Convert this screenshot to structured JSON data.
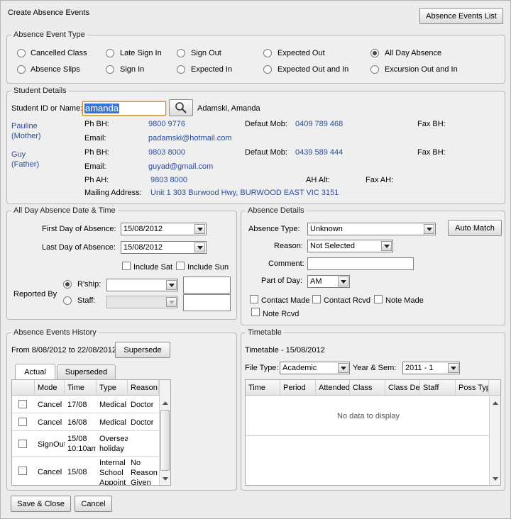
{
  "window": {
    "title": "Create Absence Events",
    "events_list_button": "Absence Events List"
  },
  "event_type": {
    "legend": "Absence Event Type",
    "options": [
      {
        "label": "Cancelled Class",
        "selected": false
      },
      {
        "label": "Late Sign In",
        "selected": false
      },
      {
        "label": "Sign Out",
        "selected": false
      },
      {
        "label": "Expected Out",
        "selected": false
      },
      {
        "label": "All Day Absence",
        "selected": true
      },
      {
        "label": "Absence Slips",
        "selected": false
      },
      {
        "label": "Sign In",
        "selected": false
      },
      {
        "label": "Expected In",
        "selected": false
      },
      {
        "label": "Expected Out and In",
        "selected": false
      },
      {
        "label": "Excursion Out and In",
        "selected": false
      }
    ]
  },
  "student": {
    "legend": "Student Details",
    "id_label": "Student ID or Name:",
    "id_value": "amanda",
    "name": "Adamski, Amanda",
    "contacts": [
      {
        "name": "Pauline",
        "relation": "(Mother)",
        "ph_bh_label": "Ph BH:",
        "ph_bh": "9800 9776",
        "mob_label": "Defaut Mob:",
        "mob": "0409 789 468",
        "fax_label": "Fax BH:",
        "email_label": "Email:",
        "email": "padamski@hotmail.com"
      },
      {
        "name": "Guy",
        "relation": "(Father)",
        "ph_bh_label": "Ph BH:",
        "ph_bh": "9803 8000",
        "mob_label": "Defaut Mob:",
        "mob": "0439 589 444",
        "fax_label": "Fax BH:",
        "email_label": "Email:",
        "email": "guyad@gmail.com"
      }
    ],
    "ph_ah_label": "Ph AH:",
    "ph_ah": "9803 8000",
    "ah_alt_label": "AH Alt:",
    "fax_ah_label": "Fax AH:",
    "mailing_label": "Mailing Address:",
    "mailing_address": "Unit 1 303 Burwood Hwy, BURWOOD EAST VIC 3151"
  },
  "date_time": {
    "legend": "All Day Absence Date & Time",
    "first_label": "First Day of Absence:",
    "first_value": "15/08/2012",
    "last_label": "Last Day of Absence:",
    "last_value": "15/08/2012",
    "include_sat": "Include Sat",
    "include_sun": "Include Sun",
    "reported_by": "Reported By",
    "rship_label": "R'ship:",
    "staff_label": "Staff:"
  },
  "absence_details": {
    "legend": "Absence Details",
    "type_label": "Absence Type:",
    "type_value": "Unknown",
    "auto_match": "Auto Match",
    "reason_label": "Reason:",
    "reason_value": "Not Selected",
    "comment_label": "Comment:",
    "part_label": "Part of Day:",
    "part_value": "AM",
    "contact_made": "Contact Made",
    "contact_rcvd": "Contact Rcvd",
    "note_made": "Note Made",
    "note_rcvd": "Note Rcvd"
  },
  "history": {
    "legend": "Absence Events History",
    "range": "From 8/08/2012 to 22/08/2012",
    "supersede": "Supersede",
    "tabs": [
      "Actual",
      "Superseded"
    ],
    "columns": [
      "Mode",
      "Time",
      "Type",
      "Reason"
    ],
    "rows": [
      {
        "mode": "Cancel",
        "time": "17/08",
        "type": "Medical",
        "reason": "Doctor"
      },
      {
        "mode": "Cancel",
        "time": "16/08",
        "type": "Medical",
        "reason": "Doctor"
      },
      {
        "mode": "SignOut",
        "time": "15/08 10:10am",
        "type": "Overseas holiday",
        "reason": ""
      },
      {
        "mode": "Cancel",
        "time": "15/08",
        "type": "Internal School Appoint",
        "reason": "No Reason Given"
      }
    ]
  },
  "timetable": {
    "legend": "Timetable",
    "heading": "Timetable - 15/08/2012",
    "file_type_label": "File Type:",
    "file_type_value": "Academic",
    "year_sem_label": "Year & Sem:",
    "year_sem_value": "2011 - 1",
    "columns": [
      "Time",
      "Period",
      "Attended",
      "Class",
      "Class Desc",
      "Staff",
      "Poss Type"
    ],
    "empty": "No data to display"
  },
  "footer": {
    "save_close": "Save & Close",
    "cancel": "Cancel"
  }
}
